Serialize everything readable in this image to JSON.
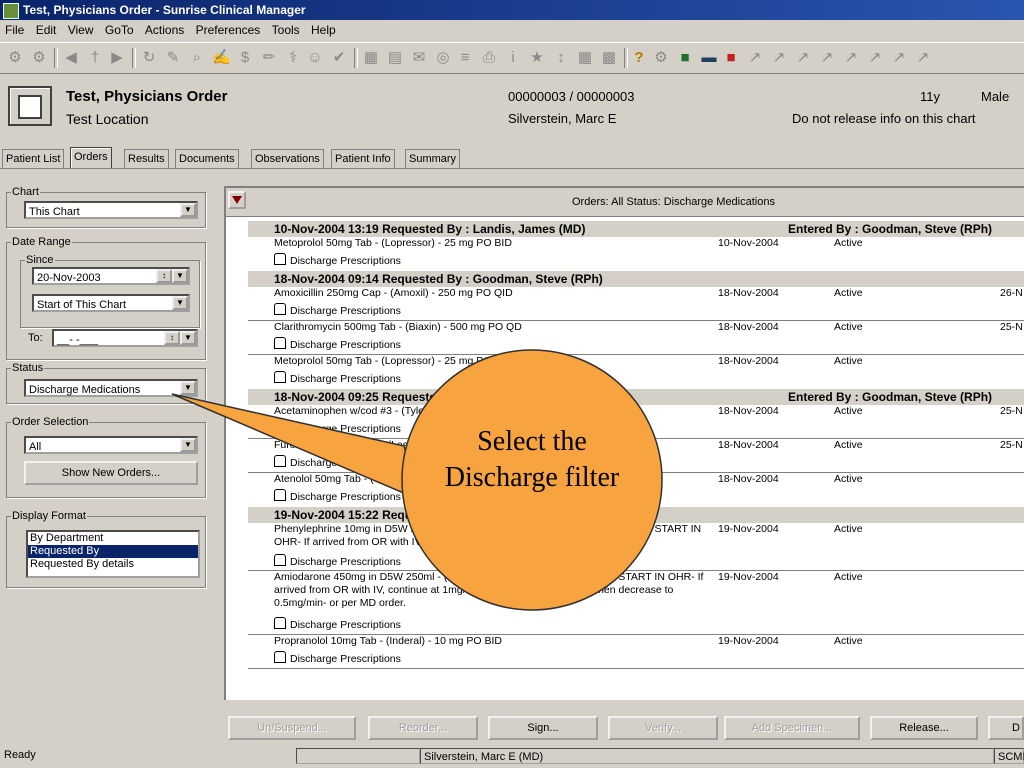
{
  "window": {
    "title": "Test, Physicians Order - Sunrise Clinical Manager"
  },
  "menu": [
    "File",
    "Edit",
    "View",
    "GoTo",
    "Actions",
    "Preferences",
    "Tools",
    "Help"
  ],
  "patient": {
    "name": "Test, Physicians Order",
    "location": "Test Location",
    "ids": "00000003 / 00000003",
    "physician": "Silverstein, Marc E",
    "age": "11y",
    "sex": "Male",
    "release_note": "Do not release info on this chart"
  },
  "tabs": [
    "Patient List",
    "Orders",
    "Results",
    "Documents",
    "Observations",
    "Patient Info",
    "Summary"
  ],
  "left": {
    "chart_label": "Chart",
    "chart_value": "This Chart",
    "date_range_label": "Date Range",
    "since_label": "Since",
    "since_date": "20-Nov-2003",
    "since_mode": "Start of This Chart",
    "to_label": "To:",
    "to_value": "__-  -___",
    "status_label": "Status",
    "status_value": "Discharge Medications",
    "order_sel_label": "Order Selection",
    "order_sel_value": "All",
    "show_new_orders": "Show New Orders...",
    "display_format_label": "Display Format",
    "display_formats": [
      "By Department",
      "Requested By",
      "Requested By details"
    ]
  },
  "orders_header": "Orders: All    Status: Discharge Medications",
  "groups": [
    {
      "left": "10-Nov-2004 13:19    Requested By :  Landis, James (MD)",
      "right": "Entered By :  Goodman, Steve (RPh)"
    },
    {
      "left": "18-Nov-2004 09:14    Requested By :  Goodman, Steve (RPh)",
      "right": ""
    },
    {
      "left": "18-Nov-2004 09:25    Requested By :  Silverstein, Marc (MD)",
      "right": "Entered By :  Goodman, Steve (RPh)"
    },
    {
      "left": "19-Nov-2004 15:22    Requested By :  Silverstein, Marc (MD)",
      "right": ""
    }
  ],
  "orders": [
    {
      "name": "Metoprolol  50mg Tab - (Lopressor) - 25 mg PO BID",
      "sub": "Discharge Prescriptions",
      "date": "10-Nov-2004",
      "status": "Active",
      "stop": ""
    },
    {
      "name": "Amoxicillin  250mg Cap - (Amoxil) - 250 mg PO QID",
      "sub": "Discharge Prescriptions",
      "date": "18-Nov-2004",
      "status": "Active",
      "stop": "26-N"
    },
    {
      "name": "Clarithromycin  500mg Tab - (Biaxin) - 500 mg PO QD",
      "sub": "Discharge Prescriptions",
      "date": "18-Nov-2004",
      "status": "Active",
      "stop": "25-N"
    },
    {
      "name": "Metoprolol  50mg Tab - (Lopressor) - 25 mg PO QD",
      "sub": "Discharge Prescriptions",
      "date": "18-Nov-2004",
      "status": "Active",
      "stop": ""
    },
    {
      "name": "Acetaminophen  w/cod #3 - (Tylenol #3) - 1 tab PO Q4H PRN",
      "sub": "Discharge Prescriptions",
      "date": "18-Nov-2004",
      "status": "Active",
      "stop": "25-N"
    },
    {
      "name": "Furosemide  20mg Tab - (Lasix) - 20 mg PO QD",
      "sub": "Discharge Prescriptions",
      "date": "18-Nov-2004",
      "status": "Active",
      "stop": "25-N"
    },
    {
      "name": "Atenolol 50mg Tab - (Tenormin) - 50 mg PO QD",
      "sub": "Discharge Prescriptions",
      "date": "18-Nov-2004",
      "status": "Active",
      "stop": ""
    },
    {
      "name": "Phenylephrine 10mg in D5W 250ml - (Neo-Synephrine) @ ___ mcg/min DO NOT START IN OHR- If arrived from OR with IV.",
      "sub": "Discharge Prescriptions",
      "date": "19-Nov-2004",
      "status": "Active",
      "stop": ""
    },
    {
      "name": "Amiodarone 450mg in D5W 250ml - (Cordarone) @ ___ mg/min DO NOT START IN OHR- If arrived from OR with IV, continue at 1mg/min for 6 hrs from initiation, then decrease to 0.5mg/min- or per MD order.",
      "sub": "Discharge Prescriptions",
      "date": "19-Nov-2004",
      "status": "Active",
      "stop": ""
    },
    {
      "name": "Propranolol  10mg Tab - (Inderal) - 10 mg PO BID",
      "sub": "Discharge Prescriptions",
      "date": "19-Nov-2004",
      "status": "Active",
      "stop": ""
    }
  ],
  "buttons": [
    "Un/Suspend...",
    "Reorder...",
    "Sign...",
    "Verify...",
    "Add Specimen...",
    "Release...",
    "D"
  ],
  "status": {
    "ready": "Ready",
    "user": "Silverstein, Marc E (MD)",
    "app": "SCMI"
  },
  "callout": {
    "text": "Select the Discharge filter",
    "color": "#f7a340"
  }
}
